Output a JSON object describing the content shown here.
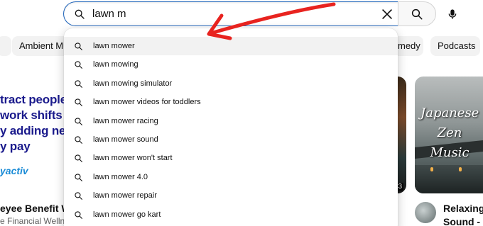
{
  "search": {
    "query": "lawn m",
    "lead_icon": "search-icon",
    "clear_icon": "close-icon",
    "button_icon": "search-icon",
    "mic_icon": "microphone-icon"
  },
  "chips": {
    "left_label": "Ambient Mu",
    "right_partial_label": "medy",
    "right_label": "Podcasts"
  },
  "suggestions": {
    "items": [
      "lawn mower",
      "lawn mowing",
      "lawn mowing simulator",
      "lawn mower videos for toddlers",
      "lawn mower racing",
      "lawn mower sound",
      "lawn mower won't start",
      "lawn mower 4.0",
      "lawn mower repair",
      "lawn mower go kart"
    ]
  },
  "background": {
    "ad_line_1": "tract people",
    "ad_line_2": "work shifts",
    "ad_line_3": "y adding nex",
    "ad_line_4": "y pay",
    "ad_logo": "yactiv",
    "left_video_title": "eyee Benefit Wit",
    "left_video_sub": "e Financial Welln",
    "thumb_title_line1": "Japanese",
    "thumb_title_line2": "Zen",
    "thumb_title_line3": "Music",
    "mid_duration": "3",
    "right_video_title_1": "Relaxing J",
    "right_video_title_2": "Sound - J"
  },
  "colors": {
    "accent_border": "#1c62b9",
    "annotation_arrow": "#e8231f",
    "ad_text": "#1a1a8c"
  }
}
